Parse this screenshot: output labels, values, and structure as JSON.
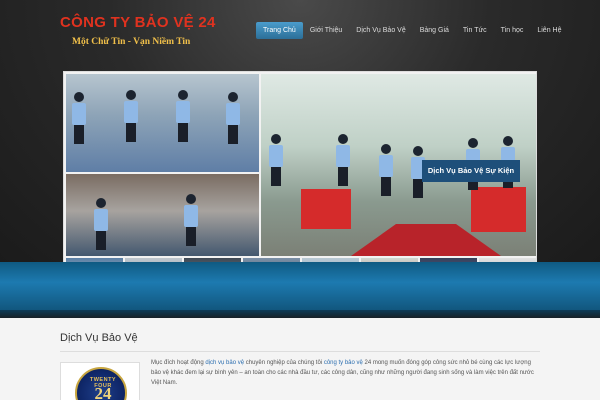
{
  "header": {
    "title": "CÔNG TY BẢO VỆ 24",
    "slogan": "Một Chữ Tin - Vạn Niềm Tin"
  },
  "nav": {
    "items": [
      {
        "label": "Trang Chủ",
        "active": true
      },
      {
        "label": "Giới Thiệu",
        "active": false
      },
      {
        "label": "Dịch Vụ Bảo Vệ",
        "active": false
      },
      {
        "label": "Bảng Giá",
        "active": false
      },
      {
        "label": "Tin Tức",
        "active": false
      },
      {
        "label": "Tin học",
        "active": false
      },
      {
        "label": "Liên Hệ",
        "active": false
      }
    ]
  },
  "slider": {
    "caption": "Dịch Vụ Bảo Vệ Sự Kiện"
  },
  "main": {
    "section_title": "Dịch Vụ Bảo Vệ",
    "badge": {
      "top_text": "TWENTY FOUR",
      "number": "24"
    },
    "description": {
      "prefix": "Mục đích hoạt động ",
      "link1": "dịch vụ bảo vệ",
      "middle": " chuyên nghiệp của chúng tôi ",
      "link2": "công ty bảo vệ",
      "suffix": " 24 mong muốn đóng góp công sức nhỏ bé cùng các lực lượng bảo vệ khác đem lại sự bình yên – an toàn cho các nhà đầu tư, các công dân, cũng như những người đang sinh sống và làm việc trên đất nước Việt Nam."
    }
  },
  "colors": {
    "title": "#e0321f",
    "slogan": "#f1c04a",
    "nav_active": "#2c6f98",
    "band": "#1d7ab0",
    "link": "#2d6fb0"
  }
}
